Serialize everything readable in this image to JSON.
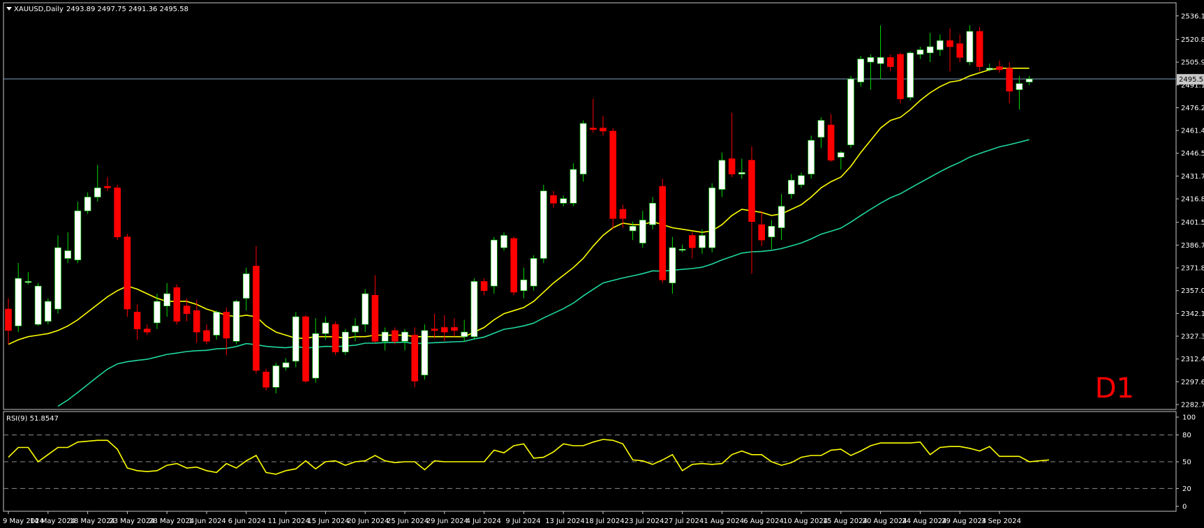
{
  "header": {
    "symbol_label": "XAUUSD,Daily",
    "ohlc": "2493.89 2497.75 2491.36 2495.58"
  },
  "timeframe_badge": "D1",
  "current_price_label": "2495.58",
  "rsi_header": "RSI(9) 51.8547",
  "colors": {
    "background": "#000000",
    "frame": "#c8c8c8",
    "bull_body": "#ffffff",
    "bear_body": "#ff0000",
    "bull_wick": "#00dd00",
    "bear_wick": "#ff0000",
    "ma_fast": "#ffff00",
    "ma_slow": "#20d8a0",
    "rsi_line": "#ffff00",
    "price_line": "#7f9fbf",
    "badge": "#ff0000"
  },
  "chart_data": [
    {
      "type": "candlestick",
      "title": "XAUUSD,Daily",
      "ylim": [
        2282.75,
        2541.0
      ],
      "y_ticks": [
        "2536.10",
        "2520.80",
        "2505.95",
        "2491.10",
        "2476.25",
        "2461.40",
        "2446.55",
        "2431.70",
        "2416.85",
        "2401.55",
        "2386.70",
        "2371.85",
        "2357.00",
        "2342.15",
        "2327.30",
        "2312.45",
        "2297.60",
        "2282.75"
      ],
      "x_tick_labels": [
        "9 May 2024",
        "14 May 2024",
        "18 May 2024",
        "23 May 2024",
        "28 May 2024",
        "1 Jun 2024",
        "6 Jun 2024",
        "11 Jun 2024",
        "15 Jun 2024",
        "20 Jun 2024",
        "25 Jun 2024",
        "29 Jun 2024",
        "4 Jul 2024",
        "9 Jul 2024",
        "13 Jul 2024",
        "18 Jul 2024",
        "23 Jul 2024",
        "27 Jul 2024",
        "1 Aug 2024",
        "6 Aug 2024",
        "10 Aug 2024",
        "15 Aug 2024",
        "20 Aug 2024",
        "24 Aug 2024",
        "29 Aug 2024",
        "3 Sep 2024"
      ],
      "x_tick_bar_index": [
        0,
        4,
        8,
        12,
        16,
        20,
        24,
        28,
        32,
        36,
        40,
        44,
        48,
        52,
        56,
        60,
        64,
        68,
        72,
        76,
        80,
        84,
        88,
        92,
        96,
        100
      ],
      "candles": [
        [
          2345,
          2331,
          2322,
          2352
        ],
        [
          2334,
          2365,
          2330,
          2375
        ],
        [
          2363,
          2363,
          2361,
          2369
        ],
        [
          2335,
          2360,
          2334,
          2362
        ],
        [
          2337,
          2350,
          2335,
          2352
        ],
        [
          2345,
          2385,
          2342,
          2393
        ],
        [
          2378,
          2383,
          2375,
          2395
        ],
        [
          2377,
          2409,
          2375,
          2415
        ],
        [
          2409,
          2418,
          2407,
          2421
        ],
        [
          2418,
          2424,
          2415,
          2439
        ],
        [
          2425,
          2424,
          2422,
          2431
        ],
        [
          2424,
          2392,
          2390,
          2426
        ],
        [
          2392,
          2345,
          2340,
          2394
        ],
        [
          2343,
          2332,
          2325,
          2348
        ],
        [
          2332,
          2330,
          2328,
          2335
        ],
        [
          2336,
          2350,
          2332,
          2355
        ],
        [
          2347,
          2355,
          2340,
          2362
        ],
        [
          2359,
          2337,
          2335,
          2361
        ],
        [
          2347,
          2342,
          2337,
          2352
        ],
        [
          2344,
          2330,
          2323,
          2351
        ],
        [
          2331,
          2324,
          2322,
          2335
        ],
        [
          2328,
          2343,
          2325,
          2344
        ],
        [
          2343,
          2326,
          2315,
          2346
        ],
        [
          2324,
          2350,
          2322,
          2351
        ],
        [
          2352,
          2368,
          2344,
          2372
        ],
        [
          2373,
          2305,
          2303,
          2386
        ],
        [
          2304,
          2294,
          2292,
          2306
        ],
        [
          2294,
          2308,
          2290,
          2310
        ],
        [
          2307,
          2310,
          2305,
          2313
        ],
        [
          2311,
          2340,
          2307,
          2343
        ],
        [
          2340,
          2298,
          2297,
          2341
        ],
        [
          2300,
          2329,
          2297,
          2339
        ],
        [
          2329,
          2336,
          2325,
          2340
        ],
        [
          2335,
          2317,
          2315,
          2337
        ],
        [
          2317,
          2330,
          2315,
          2332
        ],
        [
          2330,
          2334,
          2324,
          2339
        ],
        [
          2335,
          2355,
          2330,
          2358
        ],
        [
          2354,
          2324,
          2323,
          2367
        ],
        [
          2324,
          2330,
          2318,
          2333
        ],
        [
          2331,
          2324,
          2322,
          2333
        ],
        [
          2324,
          2330,
          2318,
          2332
        ],
        [
          2328,
          2298,
          2294,
          2333
        ],
        [
          2302,
          2331,
          2299,
          2335
        ],
        [
          2332,
          2331,
          2326,
          2342
        ],
        [
          2333,
          2330,
          2324,
          2341
        ],
        [
          2333,
          2331,
          2327,
          2339
        ],
        [
          2327,
          2330,
          2324,
          2338
        ],
        [
          2327,
          2363,
          2325,
          2365
        ],
        [
          2363,
          2357,
          2354,
          2365
        ],
        [
          2360,
          2390,
          2355,
          2392
        ],
        [
          2385,
          2393,
          2383,
          2395
        ],
        [
          2391,
          2356,
          2354,
          2392
        ],
        [
          2357,
          2364,
          2352,
          2372
        ],
        [
          2360,
          2378,
          2357,
          2380
        ],
        [
          2378,
          2422,
          2375,
          2426
        ],
        [
          2419,
          2414,
          2411,
          2422
        ],
        [
          2414,
          2417,
          2412,
          2419
        ],
        [
          2414,
          2436,
          2412,
          2440
        ],
        [
          2433,
          2466,
          2428,
          2468
        ],
        [
          2463,
          2462,
          2460,
          2482
        ],
        [
          2463,
          2461,
          2458,
          2471
        ],
        [
          2461,
          2404,
          2397,
          2463
        ],
        [
          2410,
          2404,
          2398,
          2413
        ],
        [
          2396,
          2399,
          2390,
          2402
        ],
        [
          2388,
          2403,
          2385,
          2409
        ],
        [
          2400,
          2414,
          2397,
          2418
        ],
        [
          2425,
          2364,
          2362,
          2430
        ],
        [
          2362,
          2385,
          2355,
          2392
        ],
        [
          2384,
          2384,
          2382,
          2387
        ],
        [
          2393,
          2385,
          2378,
          2395
        ],
        [
          2385,
          2393,
          2381,
          2397
        ],
        [
          2385,
          2424,
          2382,
          2427
        ],
        [
          2423,
          2442,
          2418,
          2447
        ],
        [
          2443,
          2433,
          2431,
          2473
        ],
        [
          2433,
          2434,
          2430,
          2443
        ],
        [
          2442,
          2402,
          2368,
          2451
        ],
        [
          2400,
          2390,
          2386,
          2409
        ],
        [
          2392,
          2399,
          2384,
          2403
        ],
        [
          2398,
          2412,
          2390,
          2420
        ],
        [
          2420,
          2429,
          2417,
          2433
        ],
        [
          2426,
          2432,
          2424,
          2434
        ],
        [
          2433,
          2455,
          2430,
          2458
        ],
        [
          2457,
          2468,
          2450,
          2470
        ],
        [
          2465,
          2442,
          2441,
          2472
        ],
        [
          2444,
          2447,
          2436,
          2448
        ],
        [
          2452,
          2495,
          2450,
          2497
        ],
        [
          2493,
          2508,
          2490,
          2510
        ],
        [
          2506,
          2509,
          2488,
          2511
        ],
        [
          2505,
          2509,
          2495,
          2530
        ],
        [
          2509,
          2503,
          2500,
          2511
        ],
        [
          2511,
          2482,
          2479,
          2512
        ],
        [
          2483,
          2512,
          2481,
          2513
        ],
        [
          2511,
          2514,
          2508,
          2516
        ],
        [
          2512,
          2516,
          2506,
          2525
        ],
        [
          2514,
          2520,
          2510,
          2524
        ],
        [
          2520,
          2516,
          2500,
          2528
        ],
        [
          2518,
          2509,
          2506,
          2524
        ],
        [
          2506,
          2526,
          2504,
          2530
        ],
        [
          2526,
          2503,
          2500,
          2529
        ],
        [
          2501,
          2502,
          2500,
          2505
        ],
        [
          2503,
          2501,
          2499,
          2507
        ],
        [
          2502,
          2487,
          2479,
          2506
        ],
        [
          2488,
          2492,
          2475,
          2497
        ],
        [
          2493,
          2495,
          2491,
          2497
        ]
      ],
      "ma_fast": [
        2322,
        2325,
        2327,
        2328,
        2329,
        2331,
        2334,
        2338,
        2343,
        2348,
        2353,
        2357,
        2360,
        2358,
        2355,
        2352,
        2350,
        2350,
        2350,
        2348,
        2345,
        2343,
        2341,
        2340,
        2341,
        2340,
        2334,
        2330,
        2328,
        2326,
        2326,
        2327,
        2327,
        2327,
        2326,
        2327,
        2327,
        2328,
        2328,
        2328,
        2328,
        2327,
        2327,
        2327,
        2327,
        2327,
        2327,
        2330,
        2333,
        2338,
        2342,
        2344,
        2346,
        2350,
        2356,
        2362,
        2367,
        2372,
        2378,
        2386,
        2393,
        2398,
        2401,
        2400,
        2400,
        2402,
        2400,
        2398,
        2397,
        2396,
        2395,
        2396,
        2400,
        2406,
        2410,
        2409,
        2408,
        2406,
        2407,
        2410,
        2413,
        2418,
        2424,
        2428,
        2431,
        2438,
        2447,
        2455,
        2463,
        2468,
        2470,
        2475,
        2481,
        2486,
        2490,
        2493,
        2494,
        2497,
        2499,
        2501,
        2502,
        2502,
        2502,
        2502
      ]
    },
    {
      "type": "line",
      "title": "RSI(9) 51.8547",
      "ylim": [
        0,
        100
      ],
      "y_ticks": [
        "100",
        "80",
        "50",
        "20",
        "0"
      ],
      "levels": [
        80,
        50,
        20
      ],
      "values": [
        55,
        66,
        66,
        50,
        58,
        66,
        66,
        72,
        73,
        74,
        74,
        64,
        43,
        40,
        39,
        40,
        46,
        48,
        43,
        44,
        40,
        38,
        48,
        43,
        51,
        57,
        38,
        36,
        40,
        42,
        51,
        42,
        50,
        51,
        46,
        50,
        51,
        57,
        51,
        49,
        50,
        50,
        41,
        51,
        50,
        50,
        50,
        50,
        50,
        63,
        60,
        68,
        70,
        54,
        55,
        61,
        70,
        68,
        68,
        72,
        75,
        74,
        70,
        52,
        51,
        47,
        52,
        58,
        40,
        47,
        48,
        47,
        48,
        58,
        62,
        58,
        58,
        50,
        46,
        49,
        55,
        57,
        57,
        63,
        64,
        57,
        62,
        68,
        71,
        71,
        71,
        71,
        72,
        58,
        66,
        67,
        67,
        65,
        62,
        67,
        56,
        56,
        56,
        50,
        51,
        52
      ]
    }
  ]
}
